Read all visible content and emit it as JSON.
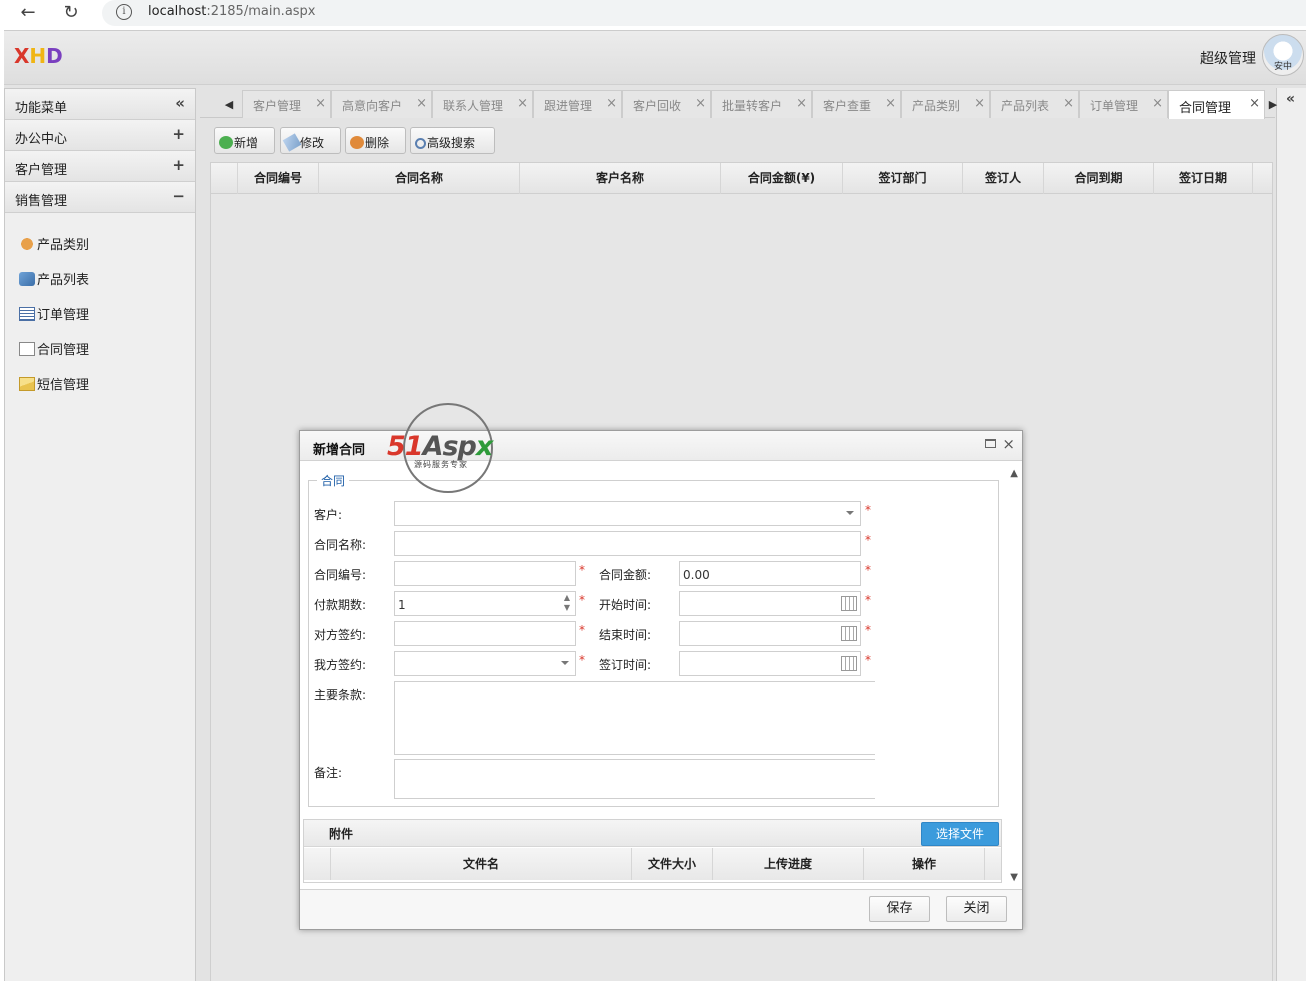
{
  "browser": {
    "url_host": "localhost",
    "url_rest": ":2185/main.aspx"
  },
  "header": {
    "logo": [
      "X",
      "H",
      "D"
    ],
    "user_name": "超级管理",
    "avatar_text": "安中"
  },
  "sidebar": {
    "title": "功能菜单",
    "collapse_glyph": "«",
    "groups": [
      {
        "label": "办公中心",
        "toggle": "+"
      },
      {
        "label": "客户管理",
        "toggle": "+"
      },
      {
        "label": "销售管理",
        "toggle": "−"
      }
    ],
    "items": [
      {
        "label": "产品类别",
        "icon": "puzzle-icon"
      },
      {
        "label": "产品列表",
        "icon": "boxes-icon"
      },
      {
        "label": "订单管理",
        "icon": "list-icon"
      },
      {
        "label": "合同管理",
        "icon": "contract-edit-icon"
      },
      {
        "label": "短信管理",
        "icon": "envelope-icon"
      }
    ]
  },
  "tabs": [
    {
      "label": "客户管理"
    },
    {
      "label": "高意向客户"
    },
    {
      "label": "联系人管理"
    },
    {
      "label": "跟进管理"
    },
    {
      "label": "客户回收"
    },
    {
      "label": "批量转客户"
    },
    {
      "label": "客户查重"
    },
    {
      "label": "产品类别"
    },
    {
      "label": "产品列表"
    },
    {
      "label": "订单管理"
    },
    {
      "label": "合同管理",
      "active": true
    }
  ],
  "toolbar": {
    "add": "新增",
    "edit": "修改",
    "delete": "删除",
    "search": "高级搜索"
  },
  "grid": {
    "columns": [
      "合同编号",
      "合同名称",
      "客户名称",
      "合同金额(¥)",
      "签订部门",
      "签订人",
      "合同到期",
      "签订日期"
    ]
  },
  "watermark": {
    "brand_red": "51",
    "brand_dark": "Asp",
    "brand_green": "x",
    "subtitle": "源码服务专家"
  },
  "dialog": {
    "title": "新增合同",
    "legend": "合同",
    "labels": {
      "customer": "客户:",
      "contract_name": "合同名称:",
      "contract_no": "合同编号:",
      "amount": "合同金额:",
      "installments": "付款期数:",
      "start_time": "开始时间:",
      "their_signer": "对方签约:",
      "end_time": "结束时间:",
      "our_signer": "我方签约:",
      "sign_time": "签订时间:",
      "main_terms": "主要条款:",
      "remarks": "备注:"
    },
    "values": {
      "amount": "0.00",
      "installments": "1"
    },
    "required_mark": "*",
    "attachments": {
      "title": "附件",
      "select_button": "选择文件",
      "columns": [
        "文件名",
        "文件大小",
        "上传进度",
        "操作"
      ]
    },
    "buttons": {
      "save": "保存",
      "close": "关闭"
    }
  },
  "colors": {
    "accent_blue": "#3b9bdc",
    "required_red": "#d9372b",
    "legend_blue": "#1f5fa8"
  }
}
